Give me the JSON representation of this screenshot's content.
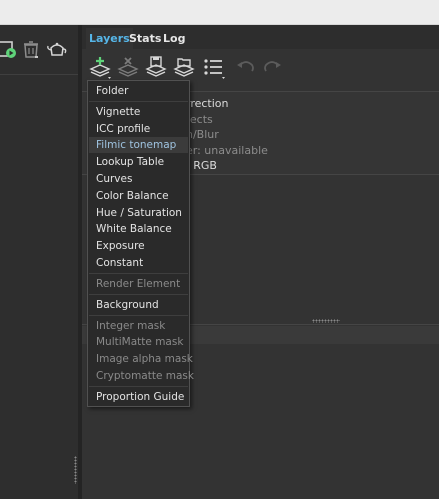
{
  "tabs": [
    {
      "label": "Layers",
      "active": true
    },
    {
      "label": "Stats",
      "active": false
    },
    {
      "label": "Log",
      "active": false
    }
  ],
  "toolbar": {
    "buttons": [
      {
        "icon": "add-layer-icon",
        "has_dropdown": true
      },
      {
        "icon": "remove-layer-icon",
        "has_dropdown": false
      },
      {
        "icon": "save-layers-icon",
        "has_dropdown": false
      },
      {
        "icon": "load-layers-icon",
        "has_dropdown": false
      },
      {
        "icon": "list-menu-icon",
        "has_dropdown": true
      },
      {
        "icon": "undo-icon",
        "has_dropdown": false
      },
      {
        "icon": "redo-icon",
        "has_dropdown": false
      }
    ]
  },
  "left_toolbar": {
    "icons": [
      "render-icon",
      "trash-icon",
      "teapot-icon"
    ]
  },
  "properties": {
    "rows": [
      {
        "text": "rrection",
        "dim": false
      },
      {
        "text": "fects",
        "dim": true
      },
      {
        "text": "n/Blur",
        "dim": true
      },
      {
        "text": "er: unavailable",
        "dim": true
      },
      {
        "text": ": RGB",
        "dim": false
      }
    ]
  },
  "menu": {
    "groups": [
      [
        {
          "label": "Folder",
          "disabled": false
        }
      ],
      [
        {
          "label": "Vignette",
          "disabled": false
        },
        {
          "label": "ICC profile",
          "disabled": false
        },
        {
          "label": "Filmic tonemap",
          "disabled": false,
          "hover": true
        },
        {
          "label": "Lookup Table",
          "disabled": false
        },
        {
          "label": "Curves",
          "disabled": false
        },
        {
          "label": "Color Balance",
          "disabled": false
        },
        {
          "label": "Hue / Saturation",
          "disabled": false
        },
        {
          "label": "White Balance",
          "disabled": false
        },
        {
          "label": "Exposure",
          "disabled": false
        },
        {
          "label": "Constant",
          "disabled": false
        }
      ],
      [
        {
          "label": "Render Element",
          "disabled": true
        }
      ],
      [
        {
          "label": "Background",
          "disabled": false
        }
      ],
      [
        {
          "label": "Integer mask",
          "disabled": true
        },
        {
          "label": "MultiMatte mask",
          "disabled": true
        },
        {
          "label": "Image alpha mask",
          "disabled": true
        },
        {
          "label": "Cryptomatte mask",
          "disabled": true
        }
      ],
      [
        {
          "label": "Proportion Guide",
          "disabled": false
        }
      ]
    ]
  },
  "colors": {
    "accent": "#56b6e8",
    "panel_bg": "#333333",
    "menu_bg": "#2a2a2a",
    "text": "#e4e4e4",
    "disabled_text": "#8a8a8a",
    "add_icon_green": "#5fd37a"
  }
}
